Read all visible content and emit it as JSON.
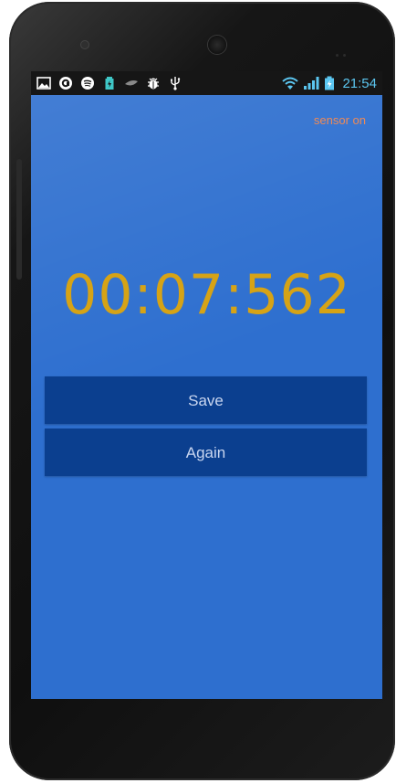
{
  "status_bar": {
    "left_icons": [
      "gallery-icon",
      "circle-app-icon",
      "spotify-icon",
      "battery-saver-icon",
      "leaf-icon",
      "bug-icon",
      "usb-icon"
    ],
    "right_icons": [
      "wifi-icon",
      "signal-icon",
      "battery-charging-icon"
    ],
    "time": "21:54"
  },
  "app": {
    "sensor_status": "sensor on",
    "timer_value": "00:07:562",
    "save_label": "Save",
    "again_label": "Again"
  },
  "colors": {
    "background": "#2e6fcf",
    "button": "#0b3f8f",
    "timer": "#d6a316",
    "sensor_status": "#f08a56",
    "clock": "#5bc6f0"
  }
}
